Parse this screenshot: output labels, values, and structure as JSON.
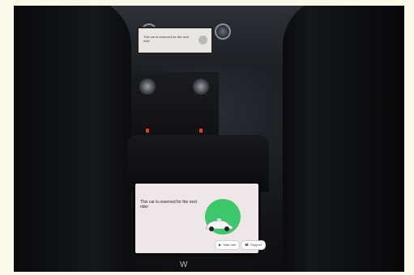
{
  "photo": {
    "subject": "Interior of a car at night showing a dashboard screen and a rear-seat screen",
    "front_screen": {
      "message": "This car is reserved for the next rider"
    },
    "rear_screen": {
      "message": "This car is reserved for the next rider",
      "buttons": [
        {
          "label": "Start ride",
          "icon": "play-icon"
        },
        {
          "label": "Support",
          "icon": "support-icon"
        }
      ],
      "accent_color": "#3dc76b"
    },
    "brand_text": "W"
  }
}
